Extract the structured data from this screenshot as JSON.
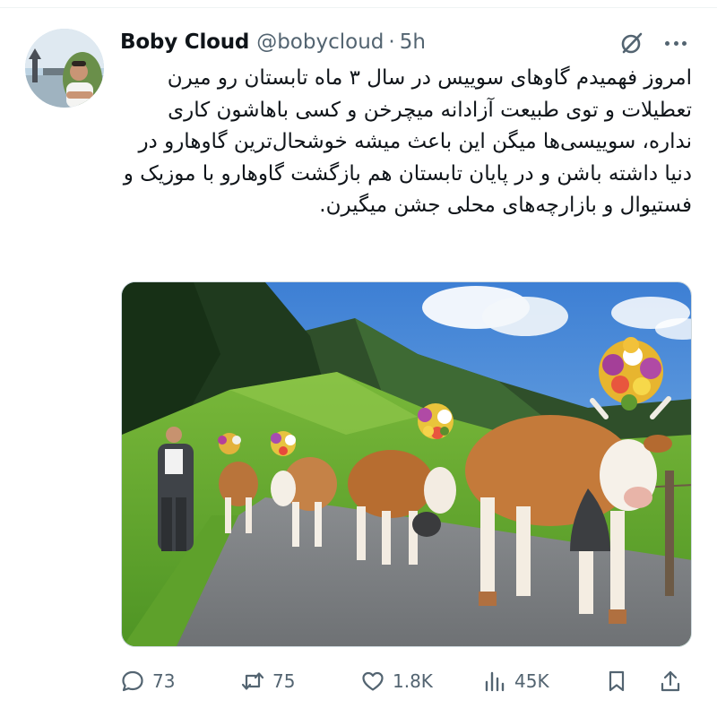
{
  "tweet": {
    "author": {
      "display_name": "Boby Cloud",
      "handle": "@bobycloud",
      "separator": "·",
      "time": "5h"
    },
    "text": "امروز فهمیدم گاوهای سوییس در سال ۳ ماه تابستان رو میرن تعطیلات و توی طبیعت آزادانه میچرخن و کسی باهاشون کاری نداره، سوییسی‌ها میگن این باعث میشه خوشحال‌ترین گاوهارو در دنیا داشته باشن و در پایان تابستان هم بازگشت گاوهارو با موزیک و فستیوال و بازارچه‌های محلی جشن میگیرن.",
    "media": {
      "icon": "photo-cows-with-flower-crowns"
    },
    "stats": {
      "replies": "73",
      "reposts": "75",
      "likes": "1.8K",
      "views": "45K"
    }
  },
  "icons": {
    "more": "more-icon",
    "grok": "grok-icon",
    "reply": "reply-icon",
    "repost": "repost-icon",
    "like": "heart-icon",
    "views": "views-icon",
    "bookmark": "bookmark-icon",
    "share": "share-icon"
  },
  "colors": {
    "text_primary": "#0f1419",
    "text_secondary": "#536471",
    "border": "#cfd9de"
  }
}
